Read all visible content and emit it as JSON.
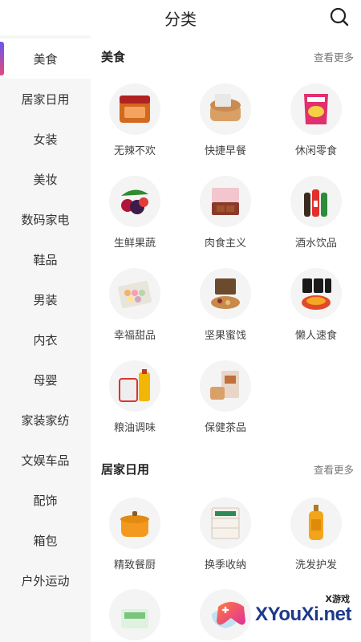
{
  "header": {
    "title": "分类",
    "search_icon": "search-icon"
  },
  "sidebar": {
    "items": [
      {
        "label": "美食",
        "active": true
      },
      {
        "label": "居家日用"
      },
      {
        "label": "女装"
      },
      {
        "label": "美妆"
      },
      {
        "label": "数码家电"
      },
      {
        "label": "鞋品"
      },
      {
        "label": "男装"
      },
      {
        "label": "内衣"
      },
      {
        "label": "母婴"
      },
      {
        "label": "家装家纺"
      },
      {
        "label": "文娱车品"
      },
      {
        "label": "配饰"
      },
      {
        "label": "箱包"
      },
      {
        "label": "户外运动"
      }
    ]
  },
  "sections": [
    {
      "title": "美食",
      "more": "查看更多",
      "items": [
        {
          "label": "无辣不欢",
          "icon": "spicy-snack-icon"
        },
        {
          "label": "快捷早餐",
          "icon": "bread-icon"
        },
        {
          "label": "休闲零食",
          "icon": "chips-bag-icon"
        },
        {
          "label": "生鲜果蔬",
          "icon": "fruit-icon"
        },
        {
          "label": "肉食主义",
          "icon": "meat-icon"
        },
        {
          "label": "酒水饮品",
          "icon": "bottles-icon"
        },
        {
          "label": "幸福甜品",
          "icon": "macaron-box-icon"
        },
        {
          "label": "坚果蜜饯",
          "icon": "nuts-icon"
        },
        {
          "label": "懒人速食",
          "icon": "instant-noodle-icon"
        },
        {
          "label": "粮油调味",
          "icon": "rice-oil-icon"
        },
        {
          "label": "保健茶品",
          "icon": "tea-box-icon"
        }
      ]
    },
    {
      "title": "居家日用",
      "more": "查看更多",
      "items": [
        {
          "label": "精致餐厨",
          "icon": "pot-icon"
        },
        {
          "label": "换季收纳",
          "icon": "storage-box-icon"
        },
        {
          "label": "洗发护发",
          "icon": "shampoo-bottle-icon"
        },
        {
          "label": "",
          "icon": "tissue-box-icon"
        },
        {
          "label": "",
          "icon": "mask-icon"
        }
      ]
    }
  ],
  "watermark": {
    "small": "X游戏",
    "big": "XYouXi.net"
  },
  "colors": {
    "accent_top": "#6a55f0",
    "accent_bottom": "#e6497a",
    "sidebar_bg": "#f6f6f7"
  }
}
